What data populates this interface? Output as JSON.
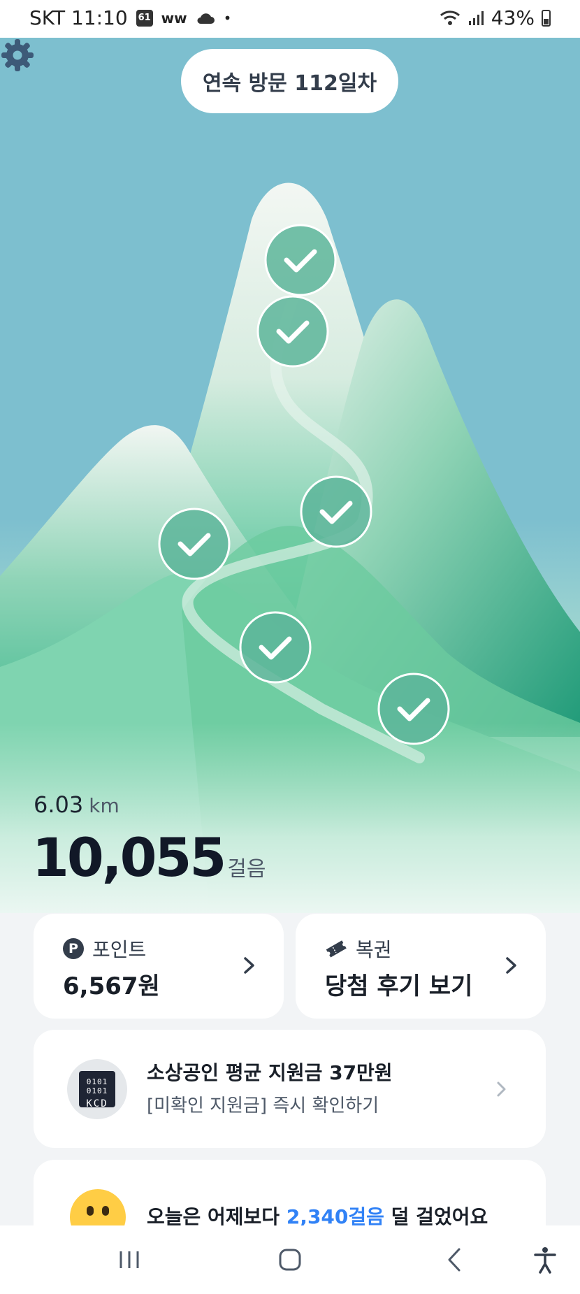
{
  "status_bar": {
    "time": "SKT 11:10",
    "app_badge": "61",
    "battery": "43%"
  },
  "header": {
    "streak_label": "연속 방문 112일차"
  },
  "summary": {
    "distance_value": "6.03",
    "distance_unit": "km",
    "steps_value": "10,055",
    "steps_unit": "걸음"
  },
  "cards": {
    "point": {
      "label": "포인트",
      "value": "6,567원",
      "icon": "p-coin-icon"
    },
    "lottery": {
      "label": "복권",
      "value": "당첨 후기 보기",
      "icon": "ticket-icon"
    }
  },
  "ad": {
    "logo_bits": "0101 0101",
    "logo_text": "KCD",
    "title": "소상공인 평균 지원금 37만원",
    "subtitle": "[미확인 지원금] 즉시 확인하기"
  },
  "compare": {
    "prefix": "오늘은 어제보다 ",
    "highlight": "2,340걸음",
    "suffix": " 덜 걸었어요"
  },
  "colors": {
    "sky": "#7dbfcf",
    "mountain_green": "#4ec49a",
    "accent_blue": "#3182f6"
  }
}
